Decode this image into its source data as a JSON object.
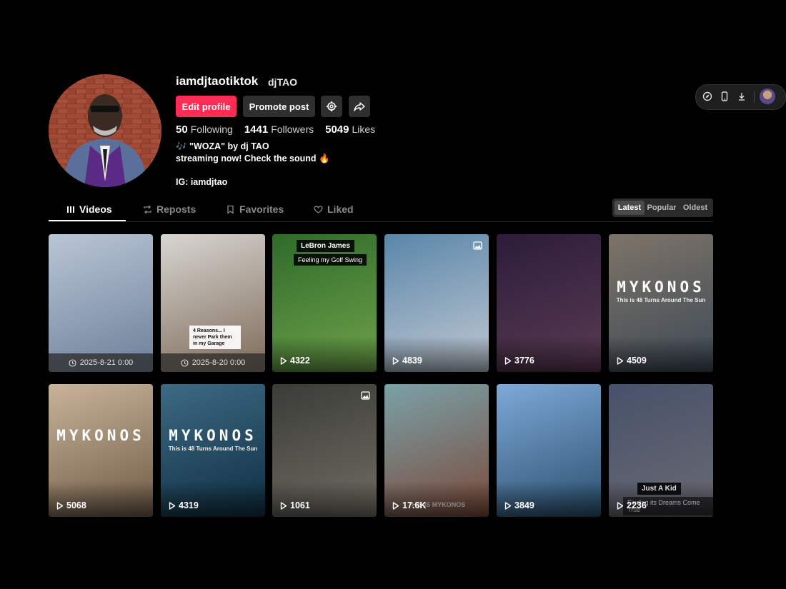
{
  "profile": {
    "username": "iamdjtaotiktok",
    "nickname": "djTAO",
    "buttons": {
      "edit": "Edit profile",
      "promote": "Promote post"
    },
    "stats": [
      {
        "value": "50",
        "label": "Following"
      },
      {
        "value": "1441",
        "label": "Followers"
      },
      {
        "value": "5049",
        "label": "Likes"
      }
    ],
    "bio": {
      "line1": "🎶 \"WOZA\" by dj TAO",
      "line2": "streaming now! Check the sound 🔥",
      "line3": "",
      "line4": "IG: iamdjtao"
    }
  },
  "tabs": [
    {
      "label": "Videos",
      "icon": "grid-icon"
    },
    {
      "label": "Reposts",
      "icon": "repost-icon"
    },
    {
      "label": "Favorites",
      "icon": "bookmark-icon"
    },
    {
      "label": "Liked",
      "icon": "heart-icon"
    }
  ],
  "sort": {
    "options": [
      "Latest",
      "Popular",
      "Oldest"
    ],
    "selected": "Latest"
  },
  "toolbar": {
    "icons": [
      "compass-icon",
      "phone-icon",
      "download-icon"
    ]
  },
  "videos": [
    {
      "kind": "date",
      "label": "2025-8-21 0:00",
      "colors": [
        "#b9c6d6",
        "#6d7f98"
      ]
    },
    {
      "kind": "date",
      "label": "2025-8-20 0:00",
      "colors": [
        "#d8d6d2",
        "#7d6a58"
      ],
      "caption": "4 Reasons... I never Park them in my Garage"
    },
    {
      "kind": "views",
      "label": "4322",
      "colors": [
        "#2f6a2a",
        "#6ea24a"
      ],
      "caption": "LeBron James",
      "caption2": "Feeling my Golf Swing"
    },
    {
      "kind": "views",
      "label": "4839",
      "colors": [
        "#5a86a9",
        "#c0c8d2"
      ],
      "badge": "photo-icon"
    },
    {
      "kind": "views",
      "label": "3776",
      "colors": [
        "#2b1c3a",
        "#5a3b52"
      ]
    },
    {
      "kind": "views",
      "label": "4509",
      "colors": [
        "#7d7468",
        "#3e4a56"
      ],
      "overlay": "MYKONOS",
      "overlay_sub": "This is 48 Turns Around The Sun"
    },
    {
      "kind": "views",
      "label": "5068",
      "colors": [
        "#c9b49a",
        "#6f5b46"
      ],
      "overlay": "MYKONOS"
    },
    {
      "kind": "views",
      "label": "4319",
      "colors": [
        "#3d6a83",
        "#0f2e43"
      ],
      "overlay": "MYKONOS",
      "overlay_sub": "This is 48 Turns Around The Sun"
    },
    {
      "kind": "views",
      "label": "1061",
      "colors": [
        "#3b3b38",
        "#6f6d62"
      ],
      "badge": "photo-icon"
    },
    {
      "kind": "views",
      "label": "17.6K",
      "colors": [
        "#7aa1a8",
        "#7a4a3a"
      ],
      "caption": "THIS IS MYKONOS"
    },
    {
      "kind": "views",
      "label": "3849",
      "colors": [
        "#7ea9d8",
        "#2b4f6e"
      ]
    },
    {
      "kind": "views",
      "label": "2236",
      "colors": [
        "#47516a",
        "#6a6a72"
      ],
      "caption": "Just A Kid",
      "caption2": "Finding its Dreams Come True"
    }
  ]
}
